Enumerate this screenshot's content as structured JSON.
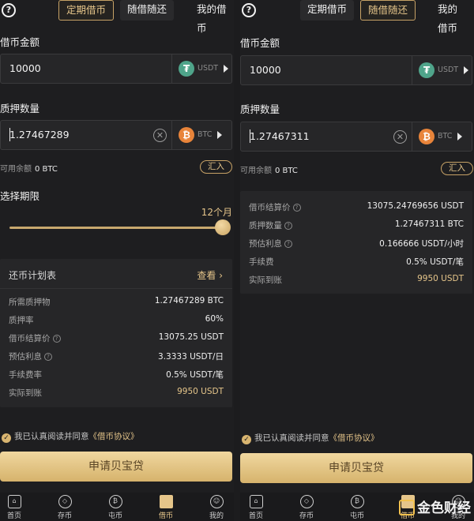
{
  "left": {
    "tabs": [
      "定期借币",
      "随借随还",
      "我的借币"
    ],
    "borrow_label": "借币金额",
    "borrow_value": "10000",
    "borrow_unit": "USDT",
    "collateral_label": "质押数量",
    "collateral_value": "1.27467289",
    "collateral_unit": "BTC",
    "balance_label": "可用余额",
    "balance_value": "0 BTC",
    "deposit_button": "汇入",
    "period_label": "选择期限",
    "period_value": "12个月",
    "period_fraction": 1.0,
    "plan_title": "还币计划表",
    "plan_link": "查看",
    "rows": [
      {
        "k": "所需质押物",
        "v": "1.27467289 BTC",
        "info": false
      },
      {
        "k": "质押率",
        "v": "60%",
        "info": false
      },
      {
        "k": "借币结算价",
        "v": "13075.25 USDT",
        "info": true
      },
      {
        "k": "预估利息",
        "v": "3.3333 USDT/日",
        "info": true
      },
      {
        "k": "手续费率",
        "v": "0.5% USDT/笔",
        "info": false
      },
      {
        "k": "实际到账",
        "v": "9950 USDT",
        "info": false
      }
    ],
    "agree_text": "我已认真阅读并同意",
    "agree_link": "《借币协议》",
    "cta": "申请贝宝贷",
    "nav": [
      "首页",
      "存币",
      "屯币",
      "借币",
      "我的"
    ]
  },
  "right": {
    "tabs": [
      "定期借币",
      "随借随还",
      "我的借币"
    ],
    "borrow_label": "借币金额",
    "borrow_value": "10000",
    "borrow_unit": "USDT",
    "collateral_label": "质押数量",
    "collateral_value": "1.27467311",
    "collateral_unit": "BTC",
    "balance_label": "可用余额",
    "balance_value": "0 BTC",
    "deposit_button": "汇入",
    "rows": [
      {
        "k": "借币结算价",
        "v": "13075.24769656 USDT",
        "info": true
      },
      {
        "k": "质押数量",
        "v": "1.27467311 BTC",
        "info": true
      },
      {
        "k": "预估利息",
        "v": "0.166666 USDT/小时",
        "info": true
      },
      {
        "k": "手续费",
        "v": "0.5% USDT/笔",
        "info": false
      },
      {
        "k": "实际到账",
        "v": "9950 USDT",
        "info": false
      }
    ],
    "agree_text": "我已认真阅读并同意",
    "agree_link": "《借币协议》",
    "cta": "申请贝宝贷",
    "nav": [
      "首页",
      "存币",
      "屯币",
      "借币",
      "我的"
    ]
  },
  "watermark": "金色财经",
  "colors": {
    "accent": "#e5c58a",
    "bg": "#1e1e20",
    "usdt": "#4fa48a",
    "btc": "#e8843a"
  }
}
